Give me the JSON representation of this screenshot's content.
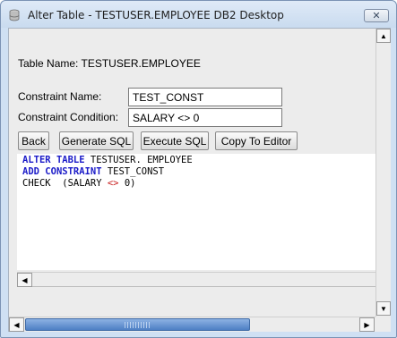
{
  "window": {
    "title": "Alter Table - TESTUSER.EMPLOYEE DB2 Desktop",
    "close_icon": "close-icon",
    "app_icon": "database-icon"
  },
  "table_name": "Table Name: TESTUSER.EMPLOYEE",
  "form": {
    "constraint_name_label": "Constraint Name:",
    "constraint_name_value": "TEST_CONST",
    "constraint_condition_label": "Constraint Condition:",
    "constraint_condition_value": "SALARY <> 0"
  },
  "buttons": {
    "back": "Back",
    "generate_sql": "Generate SQL",
    "execute_sql": "Execute SQL",
    "copy_to_editor": "Copy To Editor"
  },
  "sql": {
    "line1_kw1": "ALTER",
    "line1_kw2": "TABLE",
    "line1_rest": "TESTUSER. EMPLOYEE",
    "line2_kw1": "ADD",
    "line2_kw2": "CONSTRAINT",
    "line2_rest": "TEST_CONST",
    "line3_a": "CHECK",
    "line3_b": "(SALARY",
    "line3_op": "<>",
    "line3_c": "0)"
  },
  "colors": {
    "keyword": "#1b1bc8",
    "operator": "#c81e1e",
    "titlebar": "#cfe0f3",
    "scroll_thumb": "#4d7fc4"
  }
}
